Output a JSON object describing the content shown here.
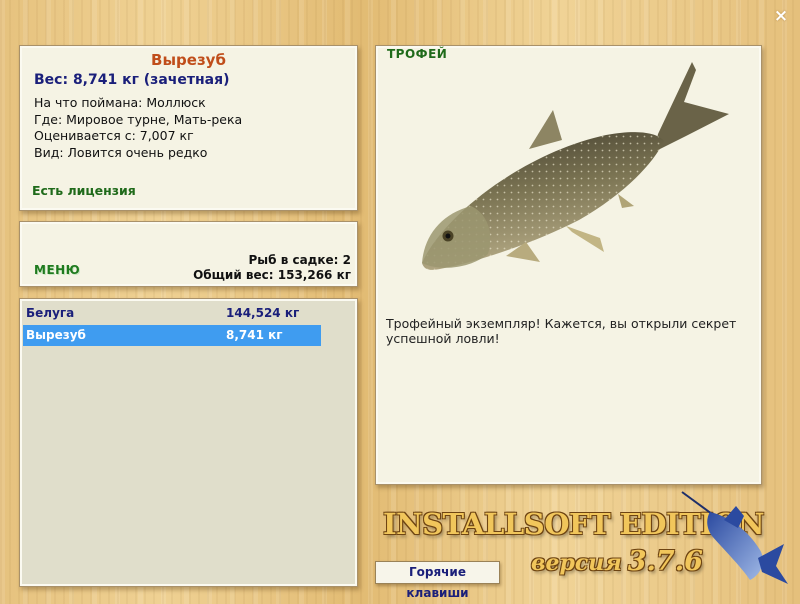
{
  "window": {
    "close_icon": "×"
  },
  "info": {
    "title": "Вырезуб",
    "weight_line": "Вес: 8,741 кг (зачетная)",
    "details": [
      "На что поймана: Моллюск",
      "Где: Мировое турне, Мать-река",
      "Оценивается с: 7,007 кг",
      "Вид: Ловится очень редко"
    ],
    "license": "Есть лицензия"
  },
  "menu": {
    "label": "МЕНЮ",
    "fish_count": "Рыб в садке: 2",
    "total_weight": "Общий вес: 153,266 кг"
  },
  "cage": {
    "items": [
      {
        "name": "Белуга",
        "weight": "144,524 кг",
        "selected": false
      },
      {
        "name": "Вырезуб",
        "weight": "8,741 кг",
        "selected": true
      }
    ]
  },
  "trophy": {
    "label": "ТРОФЕЙ",
    "text": "Трофейный экземпляр! Кажется, вы открыли секрет успешной ловли!"
  },
  "footer": {
    "hotkeys": "Горячие клавиши",
    "brand": "INSTALLSOFT EDITION",
    "version_label": "версия",
    "version_number": "3.7.6"
  },
  "colors": {
    "selected_row": "#3f9cf0",
    "title_orange": "#c04d1a",
    "text_blue": "#1a1f7a",
    "label_green": "#1f6a1a"
  }
}
